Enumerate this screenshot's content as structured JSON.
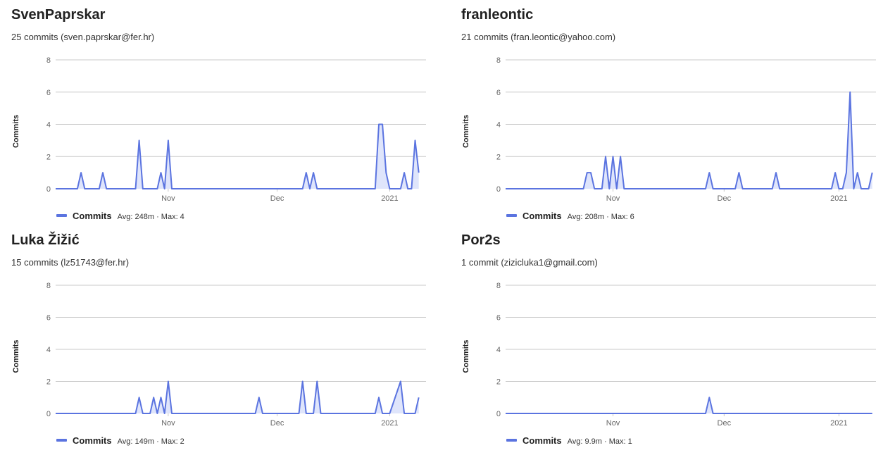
{
  "theme": {
    "line_color": "#5b74e0",
    "fill_color": "#dfe5fb",
    "grid_color": "#c8c8c8",
    "baseline_color": "#5b74e0"
  },
  "panels": [
    {
      "name": "SvenPaprskar",
      "subtitle": "25 commits (sven.paprskar@fer.hr)",
      "legend": {
        "label": "Commits",
        "stats": "Avg: 248m · Max: 4"
      }
    },
    {
      "name": "franleontic",
      "subtitle": "21 commits (fran.leontic@yahoo.com)",
      "legend": {
        "label": "Commits",
        "stats": "Avg: 208m · Max: 6"
      }
    },
    {
      "name": "Luka Žižić",
      "subtitle": "15 commits (lz51743@fer.hr)",
      "legend": {
        "label": "Commits",
        "stats": "Avg: 149m · Max: 2"
      }
    },
    {
      "name": "Por2s",
      "subtitle": "1 commit (zizicluka1@gmail.com)",
      "legend": {
        "label": "Commits",
        "stats": "Avg: 9.9m · Max: 1"
      }
    }
  ],
  "chart_data": [
    {
      "type": "area",
      "ylabel": "Commits",
      "ylim": [
        0,
        8
      ],
      "y_ticks": [
        0,
        2,
        4,
        6,
        8
      ],
      "x_ticks": [
        "Nov",
        "Dec",
        "2021"
      ],
      "x_tick_days": [
        31,
        61,
        92
      ],
      "xlim_days": [
        0,
        102
      ],
      "grid": true,
      "series": [
        {
          "name": "Commits",
          "points": [
            [
              0,
              0
            ],
            [
              6,
              0
            ],
            [
              7,
              1
            ],
            [
              8,
              0
            ],
            [
              12,
              0
            ],
            [
              13,
              1
            ],
            [
              14,
              0
            ],
            [
              22,
              0
            ],
            [
              23,
              3
            ],
            [
              24,
              0
            ],
            [
              28,
              0
            ],
            [
              29,
              1
            ],
            [
              30,
              0
            ],
            [
              31,
              3
            ],
            [
              32,
              0
            ],
            [
              68,
              0
            ],
            [
              69,
              1
            ],
            [
              70,
              0
            ],
            [
              71,
              1
            ],
            [
              72,
              0
            ],
            [
              88,
              0
            ],
            [
              89,
              4
            ],
            [
              90,
              4
            ],
            [
              91,
              1
            ],
            [
              92,
              0
            ],
            [
              95,
              0
            ],
            [
              96,
              1
            ],
            [
              97,
              0
            ],
            [
              98,
              0
            ],
            [
              99,
              3
            ],
            [
              100,
              1
            ]
          ]
        }
      ]
    },
    {
      "type": "area",
      "ylabel": "Commits",
      "ylim": [
        0,
        8
      ],
      "y_ticks": [
        0,
        2,
        4,
        6,
        8
      ],
      "x_ticks": [
        "Nov",
        "Dec",
        "2021"
      ],
      "x_tick_days": [
        29,
        59,
        90
      ],
      "xlim_days": [
        0,
        100
      ],
      "grid": true,
      "series": [
        {
          "name": "Commits",
          "points": [
            [
              0,
              0
            ],
            [
              21,
              0
            ],
            [
              22,
              1
            ],
            [
              23,
              1
            ],
            [
              24,
              0
            ],
            [
              26,
              0
            ],
            [
              27,
              2
            ],
            [
              28,
              0
            ],
            [
              29,
              2
            ],
            [
              30,
              0
            ],
            [
              31,
              2
            ],
            [
              32,
              0
            ],
            [
              54,
              0
            ],
            [
              55,
              1
            ],
            [
              56,
              0
            ],
            [
              62,
              0
            ],
            [
              63,
              1
            ],
            [
              64,
              0
            ],
            [
              72,
              0
            ],
            [
              73,
              1
            ],
            [
              74,
              0
            ],
            [
              88,
              0
            ],
            [
              89,
              1
            ],
            [
              90,
              0
            ],
            [
              91,
              0
            ],
            [
              92,
              1
            ],
            [
              93,
              6
            ],
            [
              94,
              0
            ],
            [
              95,
              1
            ],
            [
              96,
              0
            ],
            [
              98,
              0
            ],
            [
              99,
              1
            ]
          ]
        }
      ]
    },
    {
      "type": "area",
      "ylabel": "Commits",
      "ylim": [
        0,
        8
      ],
      "y_ticks": [
        0,
        2,
        4,
        6,
        8
      ],
      "x_ticks": [
        "Nov",
        "Dec",
        "2021"
      ],
      "x_tick_days": [
        31,
        61,
        92
      ],
      "xlim_days": [
        0,
        102
      ],
      "grid": true,
      "series": [
        {
          "name": "Commits",
          "points": [
            [
              0,
              0
            ],
            [
              22,
              0
            ],
            [
              23,
              1
            ],
            [
              24,
              0
            ],
            [
              26,
              0
            ],
            [
              27,
              1
            ],
            [
              28,
              0
            ],
            [
              29,
              1
            ],
            [
              30,
              0
            ],
            [
              31,
              2
            ],
            [
              32,
              0
            ],
            [
              55,
              0
            ],
            [
              56,
              1
            ],
            [
              57,
              0
            ],
            [
              67,
              0
            ],
            [
              68,
              2
            ],
            [
              69,
              0
            ],
            [
              71,
              0
            ],
            [
              72,
              2
            ],
            [
              73,
              0
            ],
            [
              88,
              0
            ],
            [
              89,
              1
            ],
            [
              90,
              0
            ],
            [
              92,
              0
            ],
            [
              95,
              2
            ],
            [
              96,
              0
            ],
            [
              99,
              0
            ],
            [
              100,
              1
            ]
          ]
        }
      ]
    },
    {
      "type": "area",
      "ylabel": "Commits",
      "ylim": [
        0,
        8
      ],
      "y_ticks": [
        0,
        2,
        4,
        6,
        8
      ],
      "x_ticks": [
        "Nov",
        "Dec",
        "2021"
      ],
      "x_tick_days": [
        29,
        59,
        90
      ],
      "xlim_days": [
        0,
        100
      ],
      "grid": true,
      "series": [
        {
          "name": "Commits",
          "points": [
            [
              0,
              0
            ],
            [
              54,
              0
            ],
            [
              55,
              1
            ],
            [
              56,
              0
            ],
            [
              99,
              0
            ]
          ]
        }
      ]
    }
  ]
}
